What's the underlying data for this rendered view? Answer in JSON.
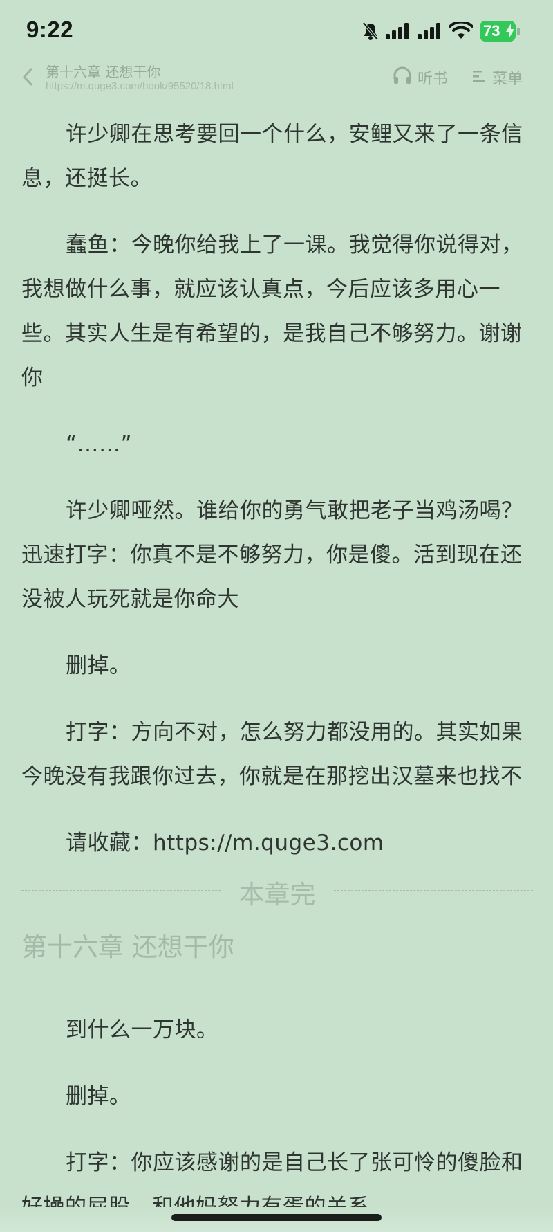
{
  "status_bar": {
    "time": "9:22",
    "battery": "73",
    "icons": [
      "bell-muted-icon",
      "signal-icon",
      "signal-icon",
      "wifi-icon",
      "battery-charging-icon"
    ]
  },
  "header": {
    "chapter_title": "第十六章 还想干你",
    "url": "https://m.quge3.com/book/95520/18.html",
    "listen_label": "听书",
    "menu_label": "菜单"
  },
  "paragraphs": [
    "许少卿在思考要回一个什么，安鲤又来了一条信息，还挺长。",
    "蠢鱼：今晚你给我上了一课。我觉得你说得对，我想做什么事，就应该认真点，今后应该多用心一些。其实人生是有希望的，是我自己不够努力。谢谢你",
    "“……”",
    "许少卿哑然。谁给你的勇气敢把老子当鸡汤喝？迅速打字：你真不是不够努力，你是傻。活到现在还没被人玩死就是你命大",
    "删掉。",
    "打字：方向不对，怎么努力都没用的。其实如果今晚没有我跟你过去，你就是在那挖出汉墓来也找不",
    "请收藏：https://m.quge3.com"
  ],
  "chapter_end_label": "本章完",
  "next_chapter_title": "第十六章 还想干你",
  "next_paragraphs": [
    "到什么一万块。",
    "删掉。",
    "打字：你应该感谢的是自己长了张可怜的傻脸和好操的屁股，和他妈努力有蛋的关系"
  ],
  "colors": {
    "background": "#c7e1cc",
    "text": "#2f3531",
    "muted": "#95ac99",
    "battery": "#34c759"
  }
}
